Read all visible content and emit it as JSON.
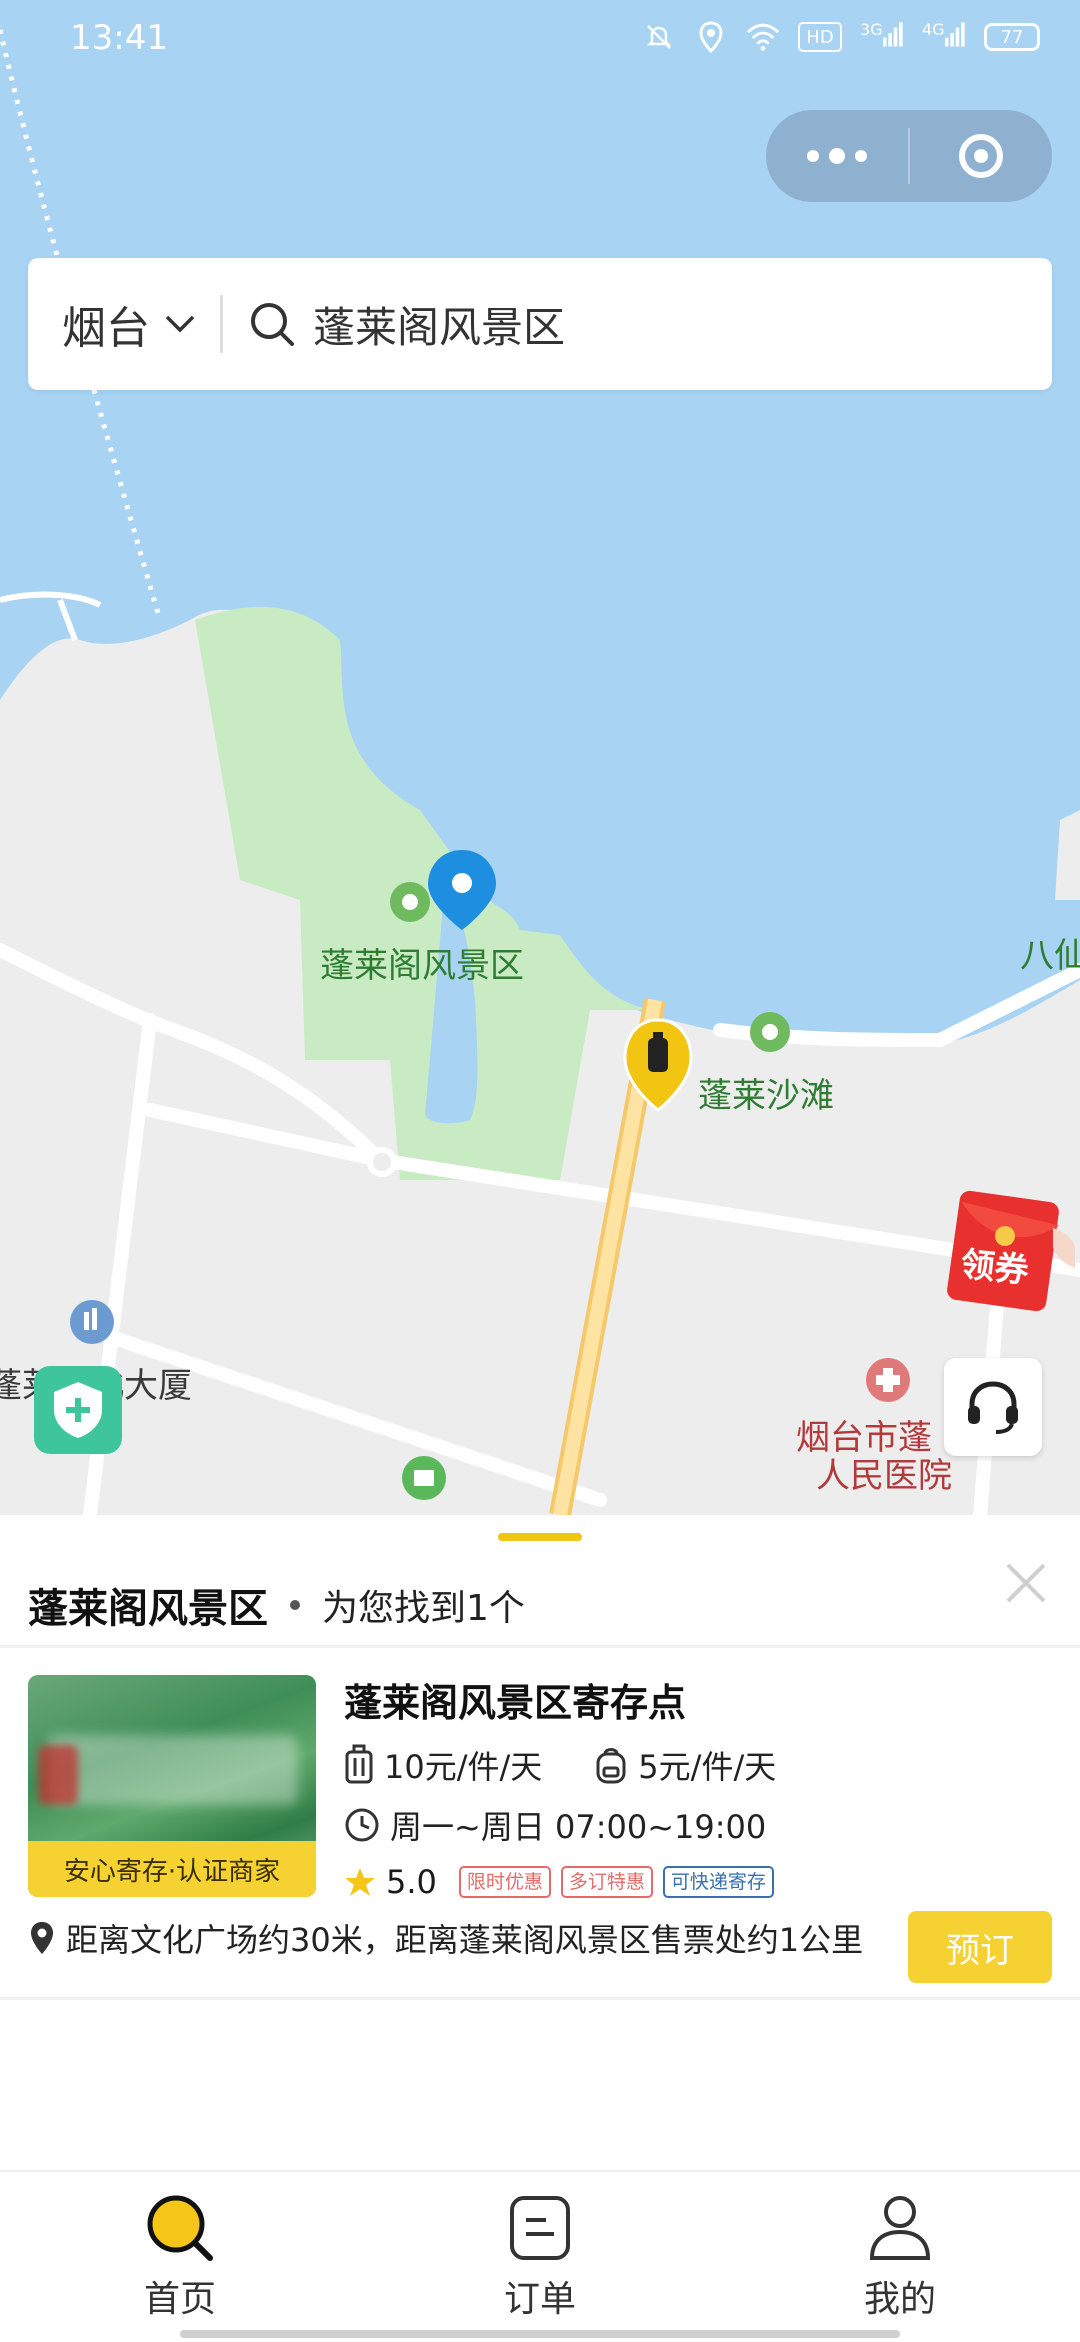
{
  "status_bar": {
    "time": "13:41",
    "battery": "77",
    "net1": "3G",
    "net2": "4G",
    "hd": "HD"
  },
  "search": {
    "city": "烟台",
    "query": "蓬莱阁风景区"
  },
  "map": {
    "labels": {
      "scenic": "蓬莱阁风景区",
      "beach": "蓬莱沙滩",
      "baxian": "八仙",
      "building": "蓬莱大北大厦",
      "hospital_line1": "烟台市蓬",
      "hospital_line2": "人民医院"
    },
    "coupon": "领券"
  },
  "sheet": {
    "title": "蓬莱阁风景区",
    "found": "为您找到1个",
    "item": {
      "name": "蓬莱阁风景区寄存点",
      "badge": "安心寄存·认证商家",
      "price_luggage": "10元/件/天",
      "price_bag": "5元/件/天",
      "hours": "周一~周日 07:00~19:00",
      "rating": "5.0",
      "tags": [
        "限时优惠",
        "多订特惠",
        "可快递寄存"
      ],
      "address": "距离文化广场约30米，距离蓬莱阁风景区售票处约1公里",
      "book": "预订"
    }
  },
  "tabs": [
    {
      "label": "首页"
    },
    {
      "label": "订单"
    },
    {
      "label": "我的"
    }
  ]
}
